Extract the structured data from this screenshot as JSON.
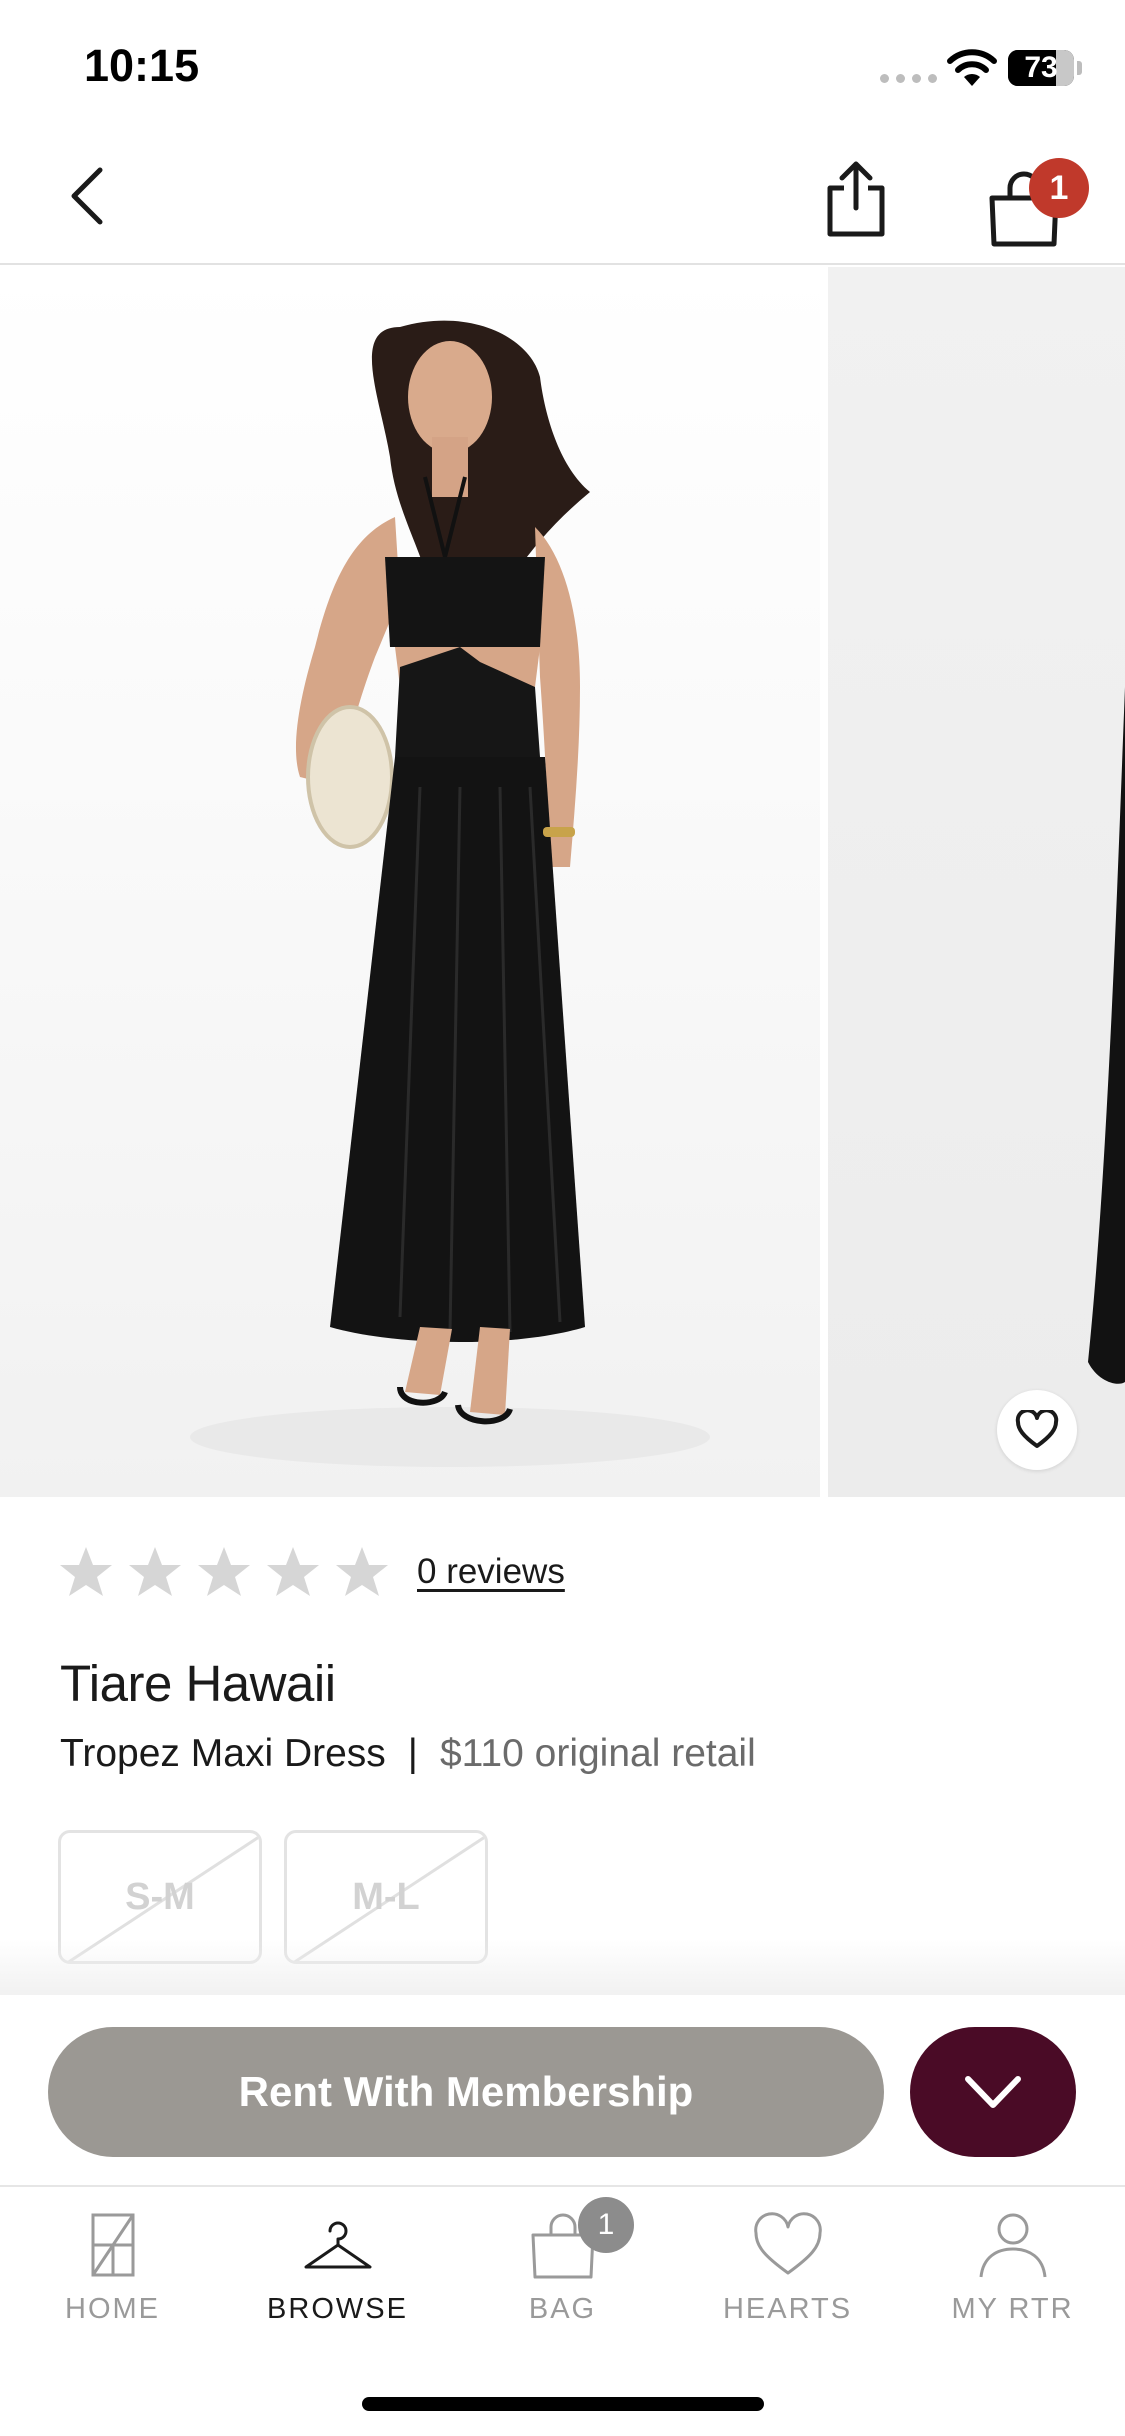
{
  "status_bar": {
    "time": "10:15",
    "battery_level": "73",
    "battery_fraction": 0.73
  },
  "header": {
    "cart_count": "1"
  },
  "product": {
    "rating": {
      "stars": 0,
      "max_stars": 5,
      "reviews_label": "0 reviews"
    },
    "brand": "Tiare Hawaii",
    "name": "Tropez Maxi Dress",
    "separator": "|",
    "price": "$110 original retail",
    "sizes": [
      {
        "label": "S-M",
        "available": false
      },
      {
        "label": "M-L",
        "available": false
      }
    ]
  },
  "actions": {
    "rent_label": "Rent With Membership"
  },
  "tab_bar": {
    "tabs": [
      {
        "label": "HOME",
        "icon": "home-icon",
        "active": false
      },
      {
        "label": "BROWSE",
        "icon": "hanger-icon",
        "active": true
      },
      {
        "label": "BAG",
        "icon": "bag-icon",
        "active": false,
        "badge": "1"
      },
      {
        "label": "HEARTS",
        "icon": "heart-icon",
        "active": false
      },
      {
        "label": "MY RTR",
        "icon": "person-icon",
        "active": false
      }
    ]
  },
  "colors": {
    "accent_burgundy": "#4a0b26",
    "rent_button_gray": "#9b9893",
    "cart_badge_red": "#c0392b",
    "star_gray": "#d6d6d6"
  }
}
